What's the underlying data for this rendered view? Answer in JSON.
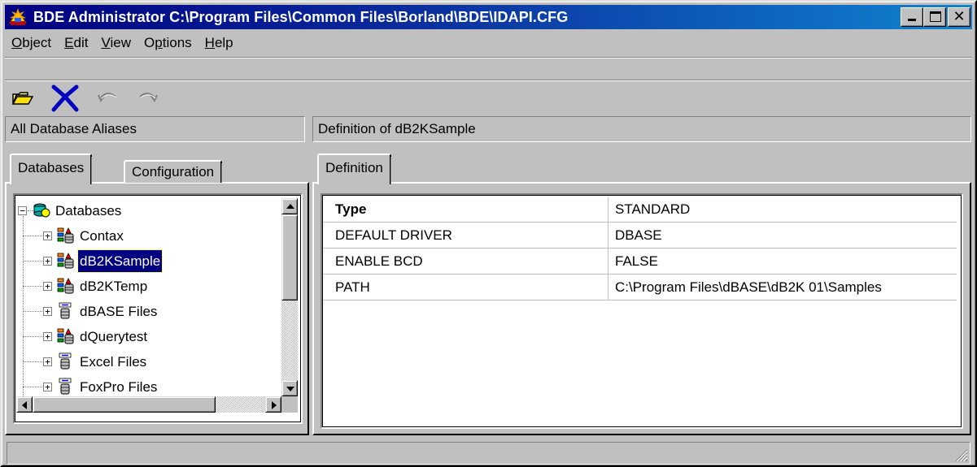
{
  "window": {
    "title": "BDE Administrator  C:\\Program Files\\Common Files\\Borland\\BDE\\IDAPI.CFG",
    "title_bar_color": "#000080",
    "selection_color": "#000080"
  },
  "menu": [
    {
      "pre": "",
      "u": "O",
      "post": "bject"
    },
    {
      "pre": "",
      "u": "E",
      "post": "dit"
    },
    {
      "pre": "",
      "u": "V",
      "post": "iew"
    },
    {
      "pre": "O",
      "u": "p",
      "post": "tions"
    },
    {
      "pre": "",
      "u": "H",
      "post": "elp"
    }
  ],
  "toolbar": {
    "icons": [
      "open-folder-icon",
      "delete-x-icon",
      "undo-icon",
      "redo-icon"
    ]
  },
  "left_panel": {
    "header": "All Database Aliases",
    "tabs": [
      "Databases",
      "Configuration"
    ],
    "active_tab": "Databases",
    "tree": {
      "root": "Databases",
      "items": [
        {
          "label": "Contax",
          "icon": "sql-alias-icon",
          "selected": false
        },
        {
          "label": "dB2KSample",
          "icon": "sql-alias-icon",
          "selected": true
        },
        {
          "label": "dB2KTemp",
          "icon": "sql-alias-icon",
          "selected": false
        },
        {
          "label": "dBASE Files",
          "icon": "odbc-alias-icon",
          "selected": false
        },
        {
          "label": "dQuerytest",
          "icon": "sql-alias-icon",
          "selected": false
        },
        {
          "label": "Excel Files",
          "icon": "odbc-alias-icon",
          "selected": false
        },
        {
          "label": "FoxPro Files",
          "icon": "odbc-alias-icon",
          "selected": false
        }
      ]
    }
  },
  "right_panel": {
    "header": "Definition of dB2KSample",
    "tabs": [
      "Definition"
    ],
    "definition_rows": [
      {
        "key": "Type",
        "value": "STANDARD",
        "bold": true
      },
      {
        "key": "DEFAULT DRIVER",
        "value": "DBASE",
        "bold": false
      },
      {
        "key": "ENABLE BCD",
        "value": "FALSE",
        "bold": false
      },
      {
        "key": "PATH",
        "value": "C:\\Program Files\\dBASE\\dB2K 01\\Samples",
        "bold": false
      }
    ]
  },
  "statusbar": {
    "text": ""
  }
}
